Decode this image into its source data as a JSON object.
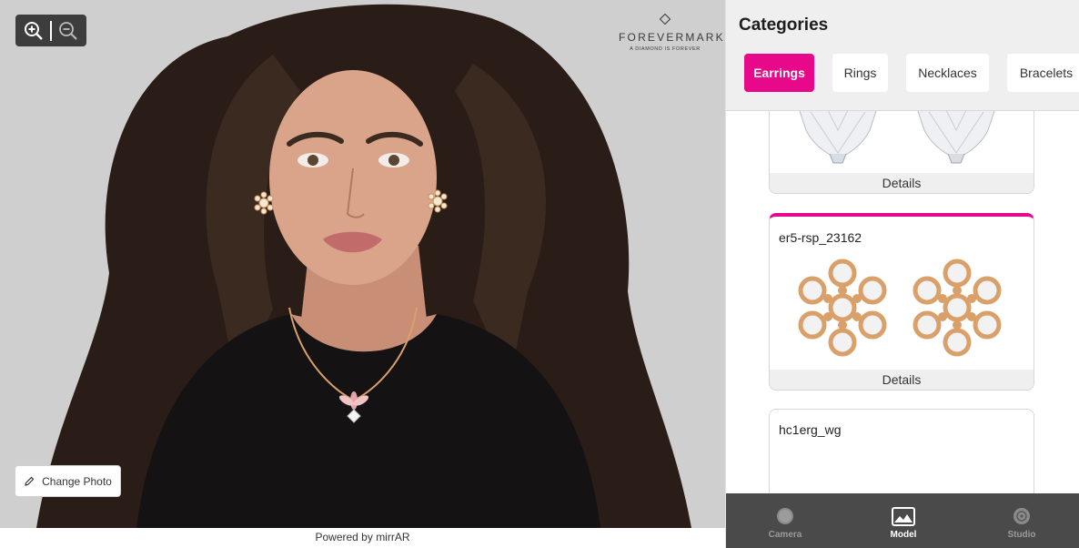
{
  "viewer": {
    "zoom_in_icon": "zoom-in-icon",
    "zoom_out_icon": "zoom-out-icon",
    "brand": {
      "name": "FOREVERMARK",
      "tagline": "A DIAMOND IS FOREVER"
    },
    "change_photo_label": "Change Photo",
    "change_photo_icon": "pencil-icon",
    "powered_by": "Powered by mirrAR"
  },
  "catalog": {
    "title": "Categories",
    "categories": [
      {
        "label": "Earrings",
        "active": true
      },
      {
        "label": "Rings",
        "active": false
      },
      {
        "label": "Necklaces",
        "active": false
      },
      {
        "label": "Bracelets",
        "active": false
      }
    ],
    "items": [
      {
        "name": "",
        "details_label": "Details",
        "selected": false
      },
      {
        "name": "er5-rsp_23162",
        "details_label": "Details",
        "selected": true
      },
      {
        "name": "hc1erg_wg",
        "details_label": "",
        "selected": false
      }
    ]
  },
  "bottom_nav": [
    {
      "label": "Camera",
      "icon": "camera-icon",
      "active": false
    },
    {
      "label": "Model",
      "icon": "image-icon",
      "active": true
    },
    {
      "label": "Studio",
      "icon": "studio-icon",
      "active": false
    }
  ],
  "colors": {
    "accent": "#e8088a",
    "backdrop": "#cfcfcf",
    "nav_bg": "#4a4a4a",
    "hair": "#2a1d17",
    "skin": "#d9a48a",
    "gold": "#d9a06a"
  }
}
